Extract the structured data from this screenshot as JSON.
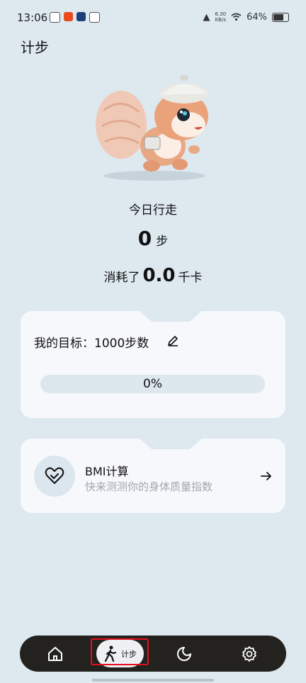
{
  "status_bar": {
    "time": "13:06",
    "net_speed_top": "6.30",
    "net_speed_bottom": "KB/s",
    "battery": "64%"
  },
  "page": {
    "title": "计步"
  },
  "today": {
    "label": "今日行走",
    "steps": "0",
    "steps_unit": "步"
  },
  "calories": {
    "label": "消耗了",
    "value": "0.0",
    "unit": "千卡"
  },
  "goal": {
    "text": "我的目标：1000步数",
    "progress_label": "0%",
    "progress_fraction": 0
  },
  "bmi": {
    "title": "BMI计算",
    "subtitle": "快来测测你的身体质量指数"
  },
  "nav": {
    "steps_label": "计步"
  },
  "icons": [
    "home-icon",
    "walking-icon",
    "moon-icon",
    "settings-icon",
    "heart-icon",
    "arrow-right-icon",
    "pencil-icon"
  ],
  "colors": {
    "background": "#dde8ef",
    "card": "#f7f8fc",
    "nav": "#23221f",
    "highlight": "#e3101b",
    "progress_track": "#dce7ee"
  }
}
